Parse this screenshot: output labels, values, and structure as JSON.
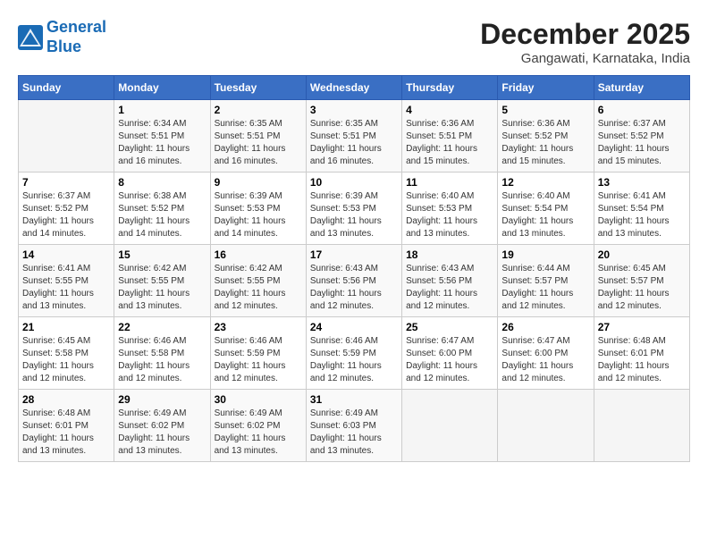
{
  "logo": {
    "line1": "General",
    "line2": "Blue"
  },
  "title": "December 2025",
  "subtitle": "Gangawati, Karnataka, India",
  "days_of_week": [
    "Sunday",
    "Monday",
    "Tuesday",
    "Wednesday",
    "Thursday",
    "Friday",
    "Saturday"
  ],
  "weeks": [
    [
      {
        "day": "",
        "info": ""
      },
      {
        "day": "1",
        "info": "Sunrise: 6:34 AM\nSunset: 5:51 PM\nDaylight: 11 hours\nand 16 minutes."
      },
      {
        "day": "2",
        "info": "Sunrise: 6:35 AM\nSunset: 5:51 PM\nDaylight: 11 hours\nand 16 minutes."
      },
      {
        "day": "3",
        "info": "Sunrise: 6:35 AM\nSunset: 5:51 PM\nDaylight: 11 hours\nand 16 minutes."
      },
      {
        "day": "4",
        "info": "Sunrise: 6:36 AM\nSunset: 5:51 PM\nDaylight: 11 hours\nand 15 minutes."
      },
      {
        "day": "5",
        "info": "Sunrise: 6:36 AM\nSunset: 5:52 PM\nDaylight: 11 hours\nand 15 minutes."
      },
      {
        "day": "6",
        "info": "Sunrise: 6:37 AM\nSunset: 5:52 PM\nDaylight: 11 hours\nand 15 minutes."
      }
    ],
    [
      {
        "day": "7",
        "info": "Sunrise: 6:37 AM\nSunset: 5:52 PM\nDaylight: 11 hours\nand 14 minutes."
      },
      {
        "day": "8",
        "info": "Sunrise: 6:38 AM\nSunset: 5:52 PM\nDaylight: 11 hours\nand 14 minutes."
      },
      {
        "day": "9",
        "info": "Sunrise: 6:39 AM\nSunset: 5:53 PM\nDaylight: 11 hours\nand 14 minutes."
      },
      {
        "day": "10",
        "info": "Sunrise: 6:39 AM\nSunset: 5:53 PM\nDaylight: 11 hours\nand 13 minutes."
      },
      {
        "day": "11",
        "info": "Sunrise: 6:40 AM\nSunset: 5:53 PM\nDaylight: 11 hours\nand 13 minutes."
      },
      {
        "day": "12",
        "info": "Sunrise: 6:40 AM\nSunset: 5:54 PM\nDaylight: 11 hours\nand 13 minutes."
      },
      {
        "day": "13",
        "info": "Sunrise: 6:41 AM\nSunset: 5:54 PM\nDaylight: 11 hours\nand 13 minutes."
      }
    ],
    [
      {
        "day": "14",
        "info": "Sunrise: 6:41 AM\nSunset: 5:55 PM\nDaylight: 11 hours\nand 13 minutes."
      },
      {
        "day": "15",
        "info": "Sunrise: 6:42 AM\nSunset: 5:55 PM\nDaylight: 11 hours\nand 13 minutes."
      },
      {
        "day": "16",
        "info": "Sunrise: 6:42 AM\nSunset: 5:55 PM\nDaylight: 11 hours\nand 12 minutes."
      },
      {
        "day": "17",
        "info": "Sunrise: 6:43 AM\nSunset: 5:56 PM\nDaylight: 11 hours\nand 12 minutes."
      },
      {
        "day": "18",
        "info": "Sunrise: 6:43 AM\nSunset: 5:56 PM\nDaylight: 11 hours\nand 12 minutes."
      },
      {
        "day": "19",
        "info": "Sunrise: 6:44 AM\nSunset: 5:57 PM\nDaylight: 11 hours\nand 12 minutes."
      },
      {
        "day": "20",
        "info": "Sunrise: 6:45 AM\nSunset: 5:57 PM\nDaylight: 11 hours\nand 12 minutes."
      }
    ],
    [
      {
        "day": "21",
        "info": "Sunrise: 6:45 AM\nSunset: 5:58 PM\nDaylight: 11 hours\nand 12 minutes."
      },
      {
        "day": "22",
        "info": "Sunrise: 6:46 AM\nSunset: 5:58 PM\nDaylight: 11 hours\nand 12 minutes."
      },
      {
        "day": "23",
        "info": "Sunrise: 6:46 AM\nSunset: 5:59 PM\nDaylight: 11 hours\nand 12 minutes."
      },
      {
        "day": "24",
        "info": "Sunrise: 6:46 AM\nSunset: 5:59 PM\nDaylight: 11 hours\nand 12 minutes."
      },
      {
        "day": "25",
        "info": "Sunrise: 6:47 AM\nSunset: 6:00 PM\nDaylight: 11 hours\nand 12 minutes."
      },
      {
        "day": "26",
        "info": "Sunrise: 6:47 AM\nSunset: 6:00 PM\nDaylight: 11 hours\nand 12 minutes."
      },
      {
        "day": "27",
        "info": "Sunrise: 6:48 AM\nSunset: 6:01 PM\nDaylight: 11 hours\nand 12 minutes."
      }
    ],
    [
      {
        "day": "28",
        "info": "Sunrise: 6:48 AM\nSunset: 6:01 PM\nDaylight: 11 hours\nand 13 minutes."
      },
      {
        "day": "29",
        "info": "Sunrise: 6:49 AM\nSunset: 6:02 PM\nDaylight: 11 hours\nand 13 minutes."
      },
      {
        "day": "30",
        "info": "Sunrise: 6:49 AM\nSunset: 6:02 PM\nDaylight: 11 hours\nand 13 minutes."
      },
      {
        "day": "31",
        "info": "Sunrise: 6:49 AM\nSunset: 6:03 PM\nDaylight: 11 hours\nand 13 minutes."
      },
      {
        "day": "",
        "info": ""
      },
      {
        "day": "",
        "info": ""
      },
      {
        "day": "",
        "info": ""
      }
    ]
  ]
}
